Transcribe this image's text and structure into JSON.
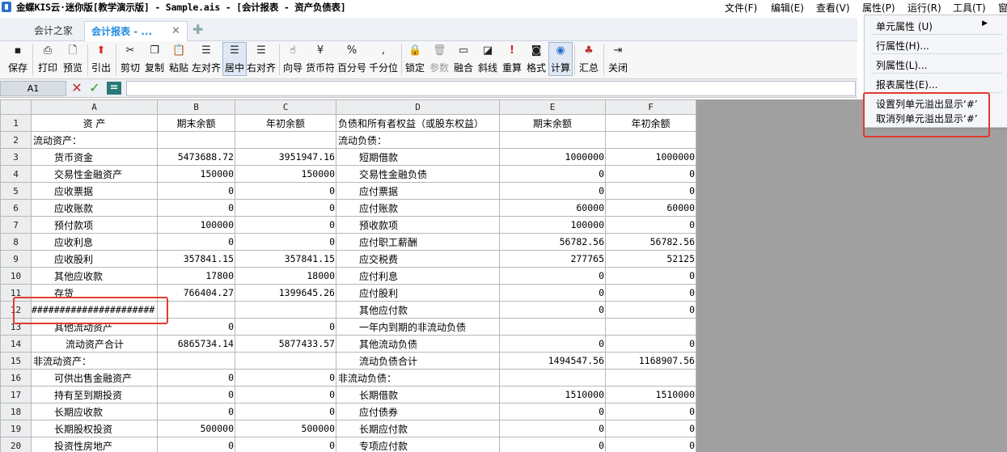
{
  "window": {
    "title": "金蝶KIS云·迷你版[教学演示版] - Sample.ais - [会计报表 - 资产负债表]"
  },
  "menubar": [
    {
      "label": "文件(F)"
    },
    {
      "label": "编辑(E)"
    },
    {
      "label": "查看(V)"
    },
    {
      "label": "属性(P)"
    },
    {
      "label": "运行(R)"
    },
    {
      "label": "工具(T)"
    },
    {
      "label": "窗"
    }
  ],
  "tabs": {
    "home": "会计之家",
    "report": "会计报表 - ...",
    "close": "✕",
    "add": "✚"
  },
  "toolbar": [
    {
      "label": "保存",
      "icon": "save-icon"
    },
    {
      "label": "打印",
      "icon": "print-icon"
    },
    {
      "label": "预览",
      "icon": "preview-icon"
    },
    {
      "label": "引出",
      "icon": "export-icon"
    },
    {
      "label": "剪切",
      "icon": "cut-icon"
    },
    {
      "label": "复制",
      "icon": "copy-icon"
    },
    {
      "label": "粘贴",
      "icon": "paste-icon"
    },
    {
      "label": "左对齐",
      "icon": "align-left-icon"
    },
    {
      "label": "居中",
      "icon": "align-center-icon"
    },
    {
      "label": "右对齐",
      "icon": "align-right-icon"
    },
    {
      "label": "向导",
      "icon": "wizard-icon"
    },
    {
      "label": "货币符",
      "icon": "currency-icon"
    },
    {
      "label": "百分号",
      "icon": "percent-icon"
    },
    {
      "label": "千分位",
      "icon": "thousands-icon"
    },
    {
      "label": "锁定",
      "icon": "lock-icon"
    },
    {
      "label": "参数",
      "icon": "trash-icon"
    },
    {
      "label": "融合",
      "icon": "merge-icon"
    },
    {
      "label": "斜线",
      "icon": "diagonal-icon"
    },
    {
      "label": "重算",
      "icon": "recalc-icon"
    },
    {
      "label": "格式",
      "icon": "format-icon"
    },
    {
      "label": "计算",
      "icon": "calculate-icon"
    },
    {
      "label": "汇总",
      "icon": "summary-icon"
    },
    {
      "label": "关闭",
      "icon": "close-door-icon"
    }
  ],
  "formulabar": {
    "cell_ref": "A1",
    "cancel": "✕",
    "confirm": "✓",
    "equals": "="
  },
  "grid": {
    "columns": [
      "A",
      "B",
      "C",
      "D",
      "E",
      "F"
    ],
    "rows": [
      {
        "n": "1",
        "a": "资    产",
        "b": "期末余额",
        "c": "年初余额",
        "d": "负债和所有者权益（或股东权益）",
        "e": "期末余额",
        "f": "年初余额"
      },
      {
        "n": "2",
        "a": "流动资产：",
        "b": "",
        "c": "",
        "d": "流动负债：",
        "e": "",
        "f": ""
      },
      {
        "n": "3",
        "a": "货币资金",
        "b": "5473688.72",
        "c": "3951947.16",
        "d": "短期借款",
        "e": "1000000",
        "f": "1000000"
      },
      {
        "n": "4",
        "a": "交易性金融资产",
        "b": "150000",
        "c": "150000",
        "d": "交易性金融负债",
        "e": "0",
        "f": "0"
      },
      {
        "n": "5",
        "a": "应收票据",
        "b": "0",
        "c": "0",
        "d": "应付票据",
        "e": "0",
        "f": "0"
      },
      {
        "n": "6",
        "a": "应收账款",
        "b": "0",
        "c": "0",
        "d": "应付账款",
        "e": "60000",
        "f": "60000"
      },
      {
        "n": "7",
        "a": "预付款项",
        "b": "100000",
        "c": "0",
        "d": "预收款项",
        "e": "100000",
        "f": "0"
      },
      {
        "n": "8",
        "a": "应收利息",
        "b": "0",
        "c": "0",
        "d": "应付职工薪酬",
        "e": "56782.56",
        "f": "56782.56"
      },
      {
        "n": "9",
        "a": "应收股利",
        "b": "357841.15",
        "c": "357841.15",
        "d": "应交税费",
        "e": "277765",
        "f": "52125"
      },
      {
        "n": "10",
        "a": "其他应收款",
        "b": "17800",
        "c": "18000",
        "d": "应付利息",
        "e": "0",
        "f": "0"
      },
      {
        "n": "11",
        "a": "存货",
        "b": "766404.27",
        "c": "1399645.26",
        "d": "应付股利",
        "e": "0",
        "f": "0"
      },
      {
        "n": "12",
        "a": "######################",
        "b": "",
        "c": "",
        "d": "其他应付款",
        "e": "0",
        "f": "0"
      },
      {
        "n": "13",
        "a": "其他流动资产",
        "b": "0",
        "c": "0",
        "d": "一年内到期的非流动负债",
        "e": "",
        "f": ""
      },
      {
        "n": "14",
        "a": "流动资产合计",
        "b": "6865734.14",
        "c": "5877433.57",
        "d": "其他流动负债",
        "e": "0",
        "f": "0"
      },
      {
        "n": "15",
        "a": "非流动资产：",
        "b": "",
        "c": "",
        "d": "流动负债合计",
        "e": "1494547.56",
        "f": "1168907.56"
      },
      {
        "n": "16",
        "a": "可供出售金融资产",
        "b": "0",
        "c": "0",
        "d": "非流动负债：",
        "e": "",
        "f": ""
      },
      {
        "n": "17",
        "a": "持有至到期投资",
        "b": "0",
        "c": "0",
        "d": "长期借款",
        "e": "1510000",
        "f": "1510000"
      },
      {
        "n": "18",
        "a": "长期应收款",
        "b": "0",
        "c": "0",
        "d": "应付债券",
        "e": "0",
        "f": "0"
      },
      {
        "n": "19",
        "a": "长期股权投资",
        "b": "500000",
        "c": "500000",
        "d": "长期应付款",
        "e": "0",
        "f": "0"
      },
      {
        "n": "20",
        "a": "投资性房地产",
        "b": "0",
        "c": "0",
        "d": "专项应付款",
        "e": "0",
        "f": "0"
      }
    ]
  },
  "dropdown": {
    "items": [
      {
        "label": "单元属性 (U)"
      },
      {
        "label": "行属性(H)..."
      },
      {
        "label": "列属性(L)..."
      },
      {
        "label": "报表属性(E)..."
      },
      {
        "label": "设置列单元溢出显示‘#’"
      },
      {
        "label": "取消列单元溢出显示‘#’"
      }
    ],
    "arrow": "▶"
  },
  "colors": {
    "accent": "#1f8ce0",
    "highlight": "#e23a2e"
  }
}
